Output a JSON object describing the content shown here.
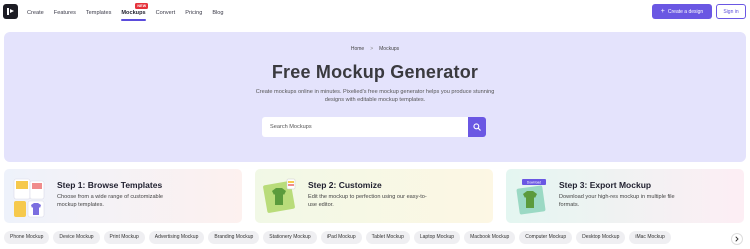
{
  "nav": {
    "links": [
      "Create",
      "Features",
      "Templates",
      "Mockups",
      "Convert",
      "Pricing",
      "Blog"
    ],
    "active_index": 3,
    "new_badge": "NEW",
    "create_button": "Create a design",
    "signin_button": "Sign in"
  },
  "hero": {
    "breadcrumb": [
      "Home",
      ">",
      "Mockups"
    ],
    "title": "Free Mockup Generator",
    "description": "Create mockups online in minutes. Pixelied's free mockup generator helps you produce stunning designs with editable mockup templates.",
    "search_placeholder": "Search Mockups"
  },
  "steps": [
    {
      "title": "Step 1: Browse Templates",
      "description": "Choose from a wide range of customizable mockup templates."
    },
    {
      "title": "Step 2: Customize",
      "description": "Edit the mockup to perfection using our easy-to-use editor."
    },
    {
      "title": "Step 3: Export Mockup",
      "description": "Download your high-res mockup in multiple file formats.",
      "art_label": "Download"
    }
  ],
  "chips": [
    "Phone Mockup",
    "Device Mockup",
    "Print Mockup",
    "Advertising Mockup",
    "Branding Mockup",
    "Stationery Mockup",
    "iPad Mockup",
    "Tablet Mockup",
    "Laptop Mockup",
    "Macbook Mockup",
    "Computer Mockup",
    "Desktop Mockup",
    "iMac Mockup"
  ],
  "colors": {
    "accent": "#6a57e3",
    "hero_bg": "#e4e3fc",
    "badge": "#e5323b"
  },
  "icons": {
    "logo": "pixelied-logo",
    "search": "search-icon",
    "plus": "plus-icon",
    "next": "chevron-right-icon"
  }
}
